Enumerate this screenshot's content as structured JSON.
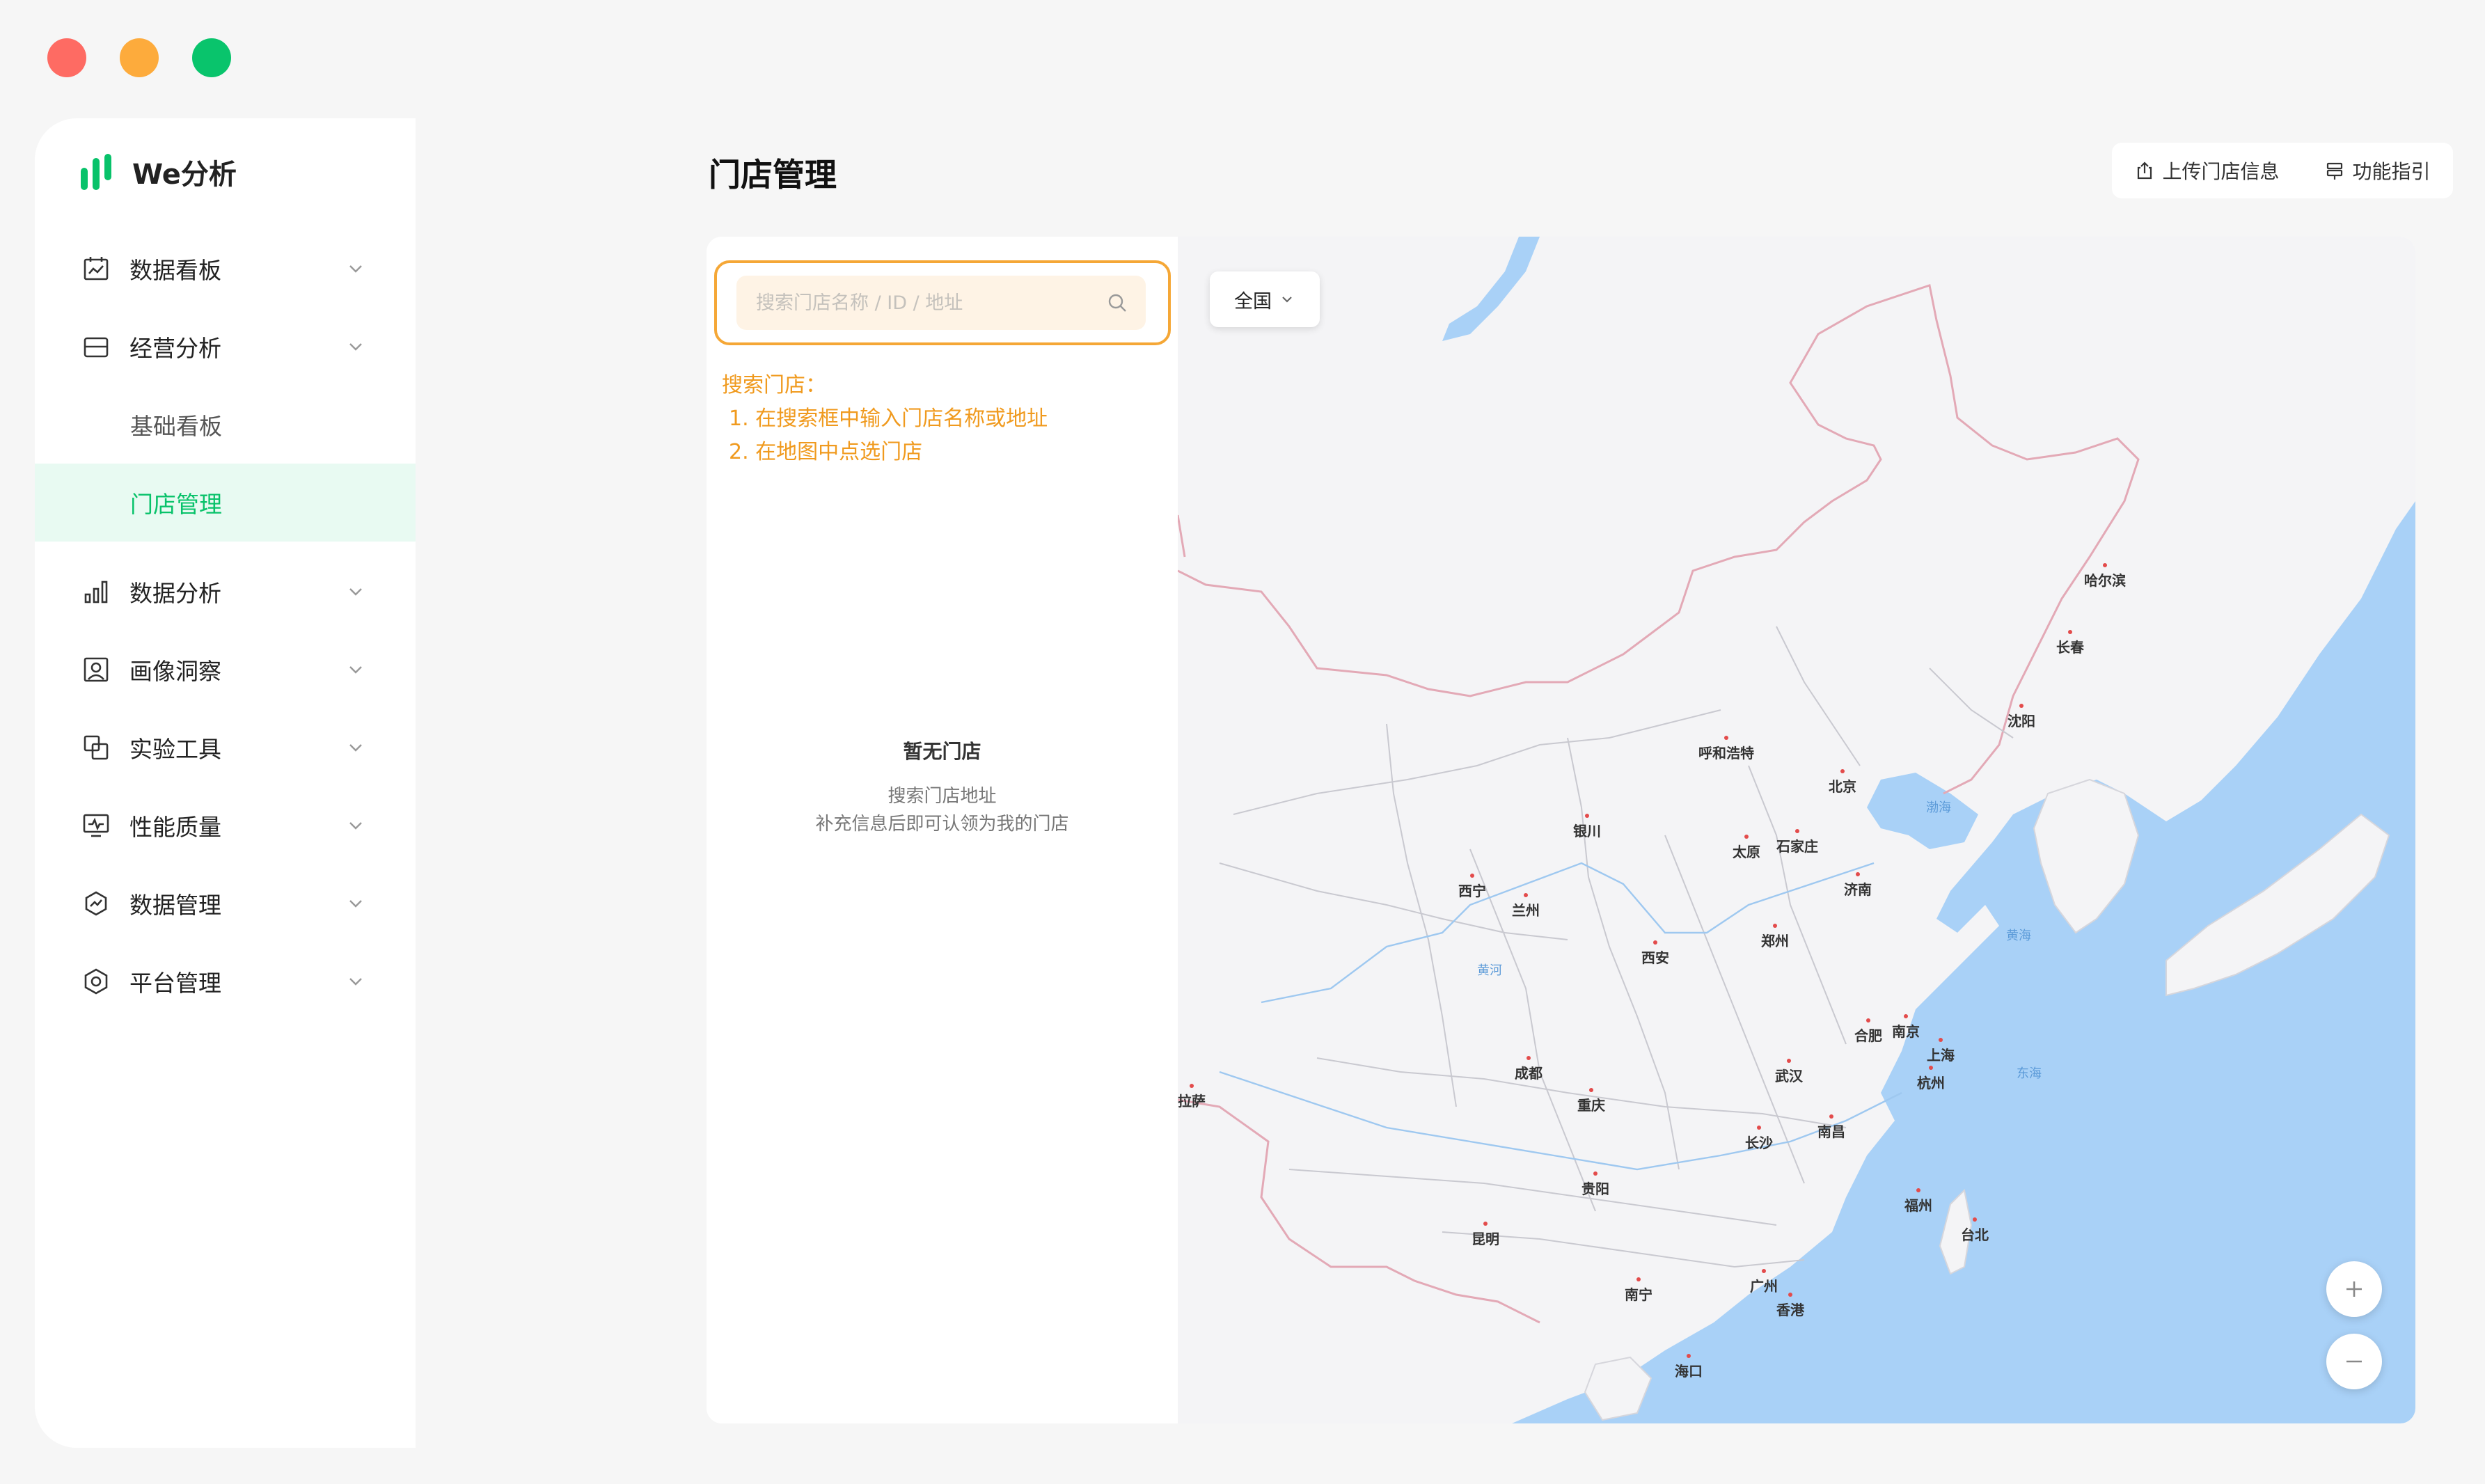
{
  "app": {
    "name": "We分析",
    "brand_color": "#08c26a",
    "accent_orange": "#f5a736"
  },
  "sidebar": {
    "items": [
      {
        "label": "数据看板",
        "icon": "calendar-chart-icon",
        "expandable": true
      },
      {
        "label": "经营分析",
        "icon": "store-icon",
        "expandable": true,
        "expanded": true
      },
      {
        "label": "基础看板",
        "sub": true
      },
      {
        "label": "门店管理",
        "sub": true,
        "active": true
      },
      {
        "label": "数据分析",
        "icon": "bar-chart-icon",
        "expandable": true
      },
      {
        "label": "画像洞察",
        "icon": "portrait-icon",
        "expandable": true
      },
      {
        "label": "实验工具",
        "icon": "overlap-squares-icon",
        "expandable": true
      },
      {
        "label": "性能质量",
        "icon": "monitor-pulse-icon",
        "expandable": true
      },
      {
        "label": "数据管理",
        "icon": "trend-circle-icon",
        "expandable": true
      },
      {
        "label": "平台管理",
        "icon": "hexagon-settings-icon",
        "expandable": true
      }
    ]
  },
  "header": {
    "title": "门店管理",
    "upload_label": "上传门店信息",
    "guide_label": "功能指引"
  },
  "store_panel": {
    "search_placeholder": "搜索门店名称 / ID / 地址",
    "tip_title": "搜索门店：",
    "tip_step1": "1. 在搜索框中输入门店名称或地址",
    "tip_step2": "2. 在地图中点选门店",
    "empty_title": "暂无门店",
    "empty_line1": "搜索门店地址",
    "empty_line2": "补充信息后即可认领为我的门店"
  },
  "map": {
    "region_selected": "全国",
    "cities": {
      "harbin": "哈尔滨",
      "changchun": "长春",
      "shenyang": "沈阳",
      "beijing": "北京",
      "hohhot": "呼和浩特",
      "yinchuan": "银川",
      "taiyuan": "太原",
      "shijiazhuang": "石家庄",
      "jinan": "济南",
      "xining": "西宁",
      "lanzhou": "兰州",
      "zhengzhou": "郑州",
      "xian": "西安",
      "hefei": "合肥",
      "nanjing": "南京",
      "shanghai": "上海",
      "hangzhou": "杭州",
      "chengdu": "成都",
      "wuhan": "武汉",
      "chongqing": "重庆",
      "lhasa": "拉萨",
      "changsha": "长沙",
      "nanchang": "南昌",
      "guiyang": "贵阳",
      "fuzhou": "福州",
      "taipei": "台北",
      "kunming": "昆明",
      "nanning": "南宁",
      "guangzhou": "广州",
      "hongkong": "香港",
      "haikou": "海口"
    },
    "seas": {
      "bohai": "渤海",
      "huanghai": "黄海",
      "donghai": "东海",
      "huanghe": "黄河"
    }
  }
}
